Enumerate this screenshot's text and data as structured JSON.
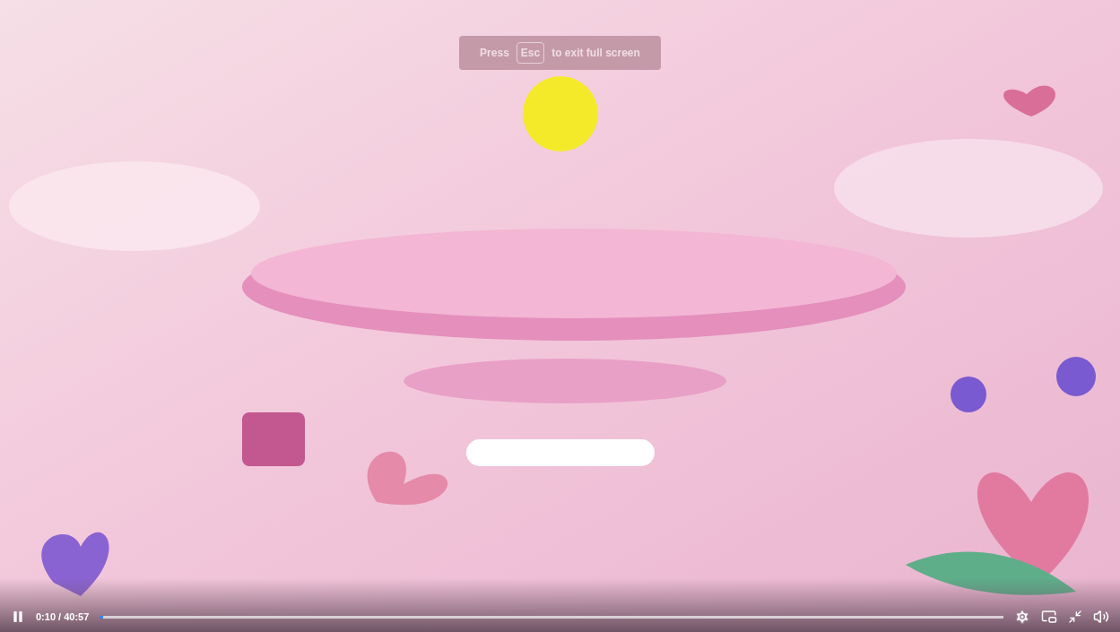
{
  "fullscreen_notice": {
    "before": "Press",
    "key": "Esc",
    "after": "to exit full screen"
  },
  "controls": {
    "playing": true,
    "time": "0:10 / 40:57",
    "progress": {
      "level": 0.004
    }
  }
}
